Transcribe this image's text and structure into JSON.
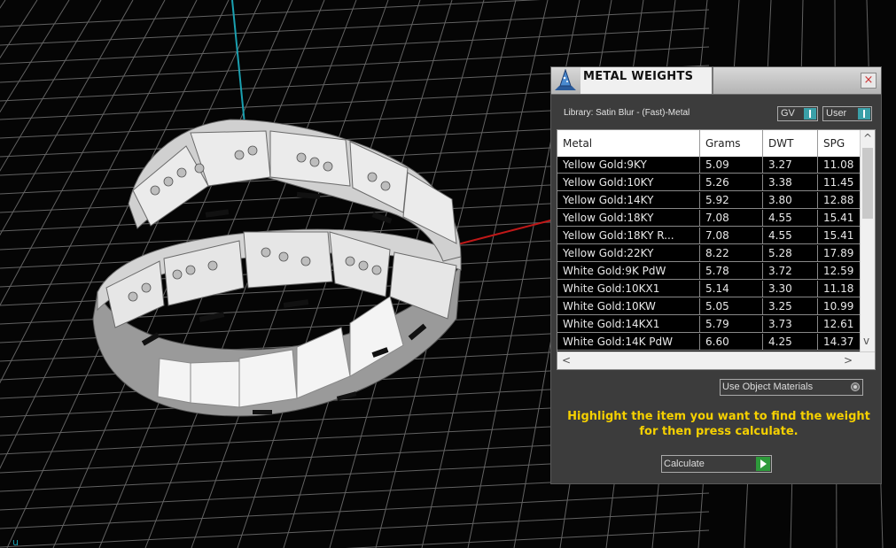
{
  "panel": {
    "title": "METAL WEIGHTS",
    "close_glyph": "×",
    "library_label": "Library: Satin Blur - (Fast)-Metal",
    "toggle_gv": "GV",
    "toggle_user": "User",
    "use_object_materials": "Use Object Materials",
    "hint": "Highlight the item you want to find the weight for then press calculate.",
    "calculate_label": "Calculate"
  },
  "table": {
    "headers": [
      "Metal",
      "Grams",
      "DWT",
      "SPG"
    ],
    "rows": [
      [
        "Yellow Gold:9KY",
        "5.09",
        "3.27",
        "11.08"
      ],
      [
        "Yellow Gold:10KY",
        "5.26",
        "3.38",
        "11.45"
      ],
      [
        "Yellow Gold:14KY",
        "5.92",
        "3.80",
        "12.88"
      ],
      [
        "Yellow Gold:18KY",
        "7.08",
        "4.55",
        "15.41"
      ],
      [
        "Yellow Gold:18KY R...",
        "7.08",
        "4.55",
        "15.41"
      ],
      [
        "Yellow Gold:22KY",
        "8.22",
        "5.28",
        "17.89"
      ],
      [
        "White Gold:9K PdW",
        "5.78",
        "3.72",
        "12.59"
      ],
      [
        "White Gold:10KX1",
        "5.14",
        "3.30",
        "11.18"
      ],
      [
        "White Gold:10KW",
        "5.05",
        "3.25",
        "10.99"
      ],
      [
        "White Gold:14KX1",
        "5.79",
        "3.73",
        "12.61"
      ],
      [
        "White Gold:14K PdW",
        "6.60",
        "4.25",
        "14.37"
      ]
    ]
  },
  "icons": {
    "logo": "wizard-hat-icon",
    "close": "close-icon",
    "toggle": "toggle-switch-icon",
    "radio": "radio-icon",
    "calculate": "play-arrow-icon"
  },
  "colors": {
    "panel_bg": "#3c3c3c",
    "hint_text": "#f5d000",
    "toggle_accent": "#3aa0a8",
    "calculate_accent": "#2e9a3b",
    "axis_cyan": "#1aa0b0",
    "axis_red": "#c01818"
  },
  "viewport": {
    "axis_label": "u"
  }
}
